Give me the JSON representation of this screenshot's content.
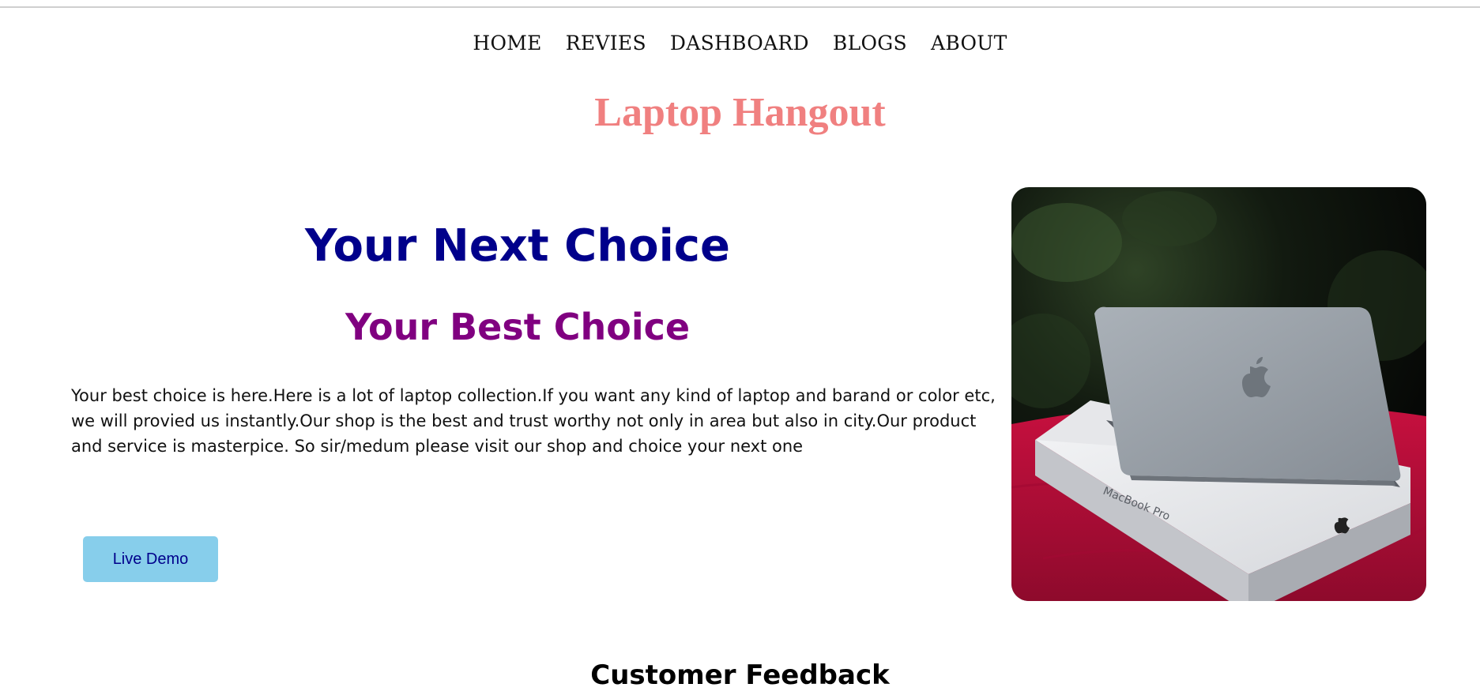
{
  "nav": {
    "items": [
      {
        "label": "HOME"
      },
      {
        "label": "REVIES"
      },
      {
        "label": "DASHBOARD"
      },
      {
        "label": "BLOGS"
      },
      {
        "label": "ABOUT"
      }
    ]
  },
  "brand": {
    "title": "Laptop Hangout",
    "color": "#f08080"
  },
  "hero": {
    "heading": "Your Next Choice",
    "subheading": "Your Best Choice",
    "description": "Your best choice is here.Here is a lot of laptop collection.If you want any kind of laptop and barand or color etc, we will provied us instantly.Our shop is the best and trust worthy not only in area but also in city.Our product and service is masterpice. So sir/medum please visit our shop and choice your next one",
    "button_label": "Live Demo",
    "heading_color": "#00008b",
    "subheading_color": "#800080",
    "button_color": "#87ceeb"
  },
  "image": {
    "box_text": "MacBook Pro"
  },
  "feedback": {
    "title": "Customer Feedback"
  }
}
